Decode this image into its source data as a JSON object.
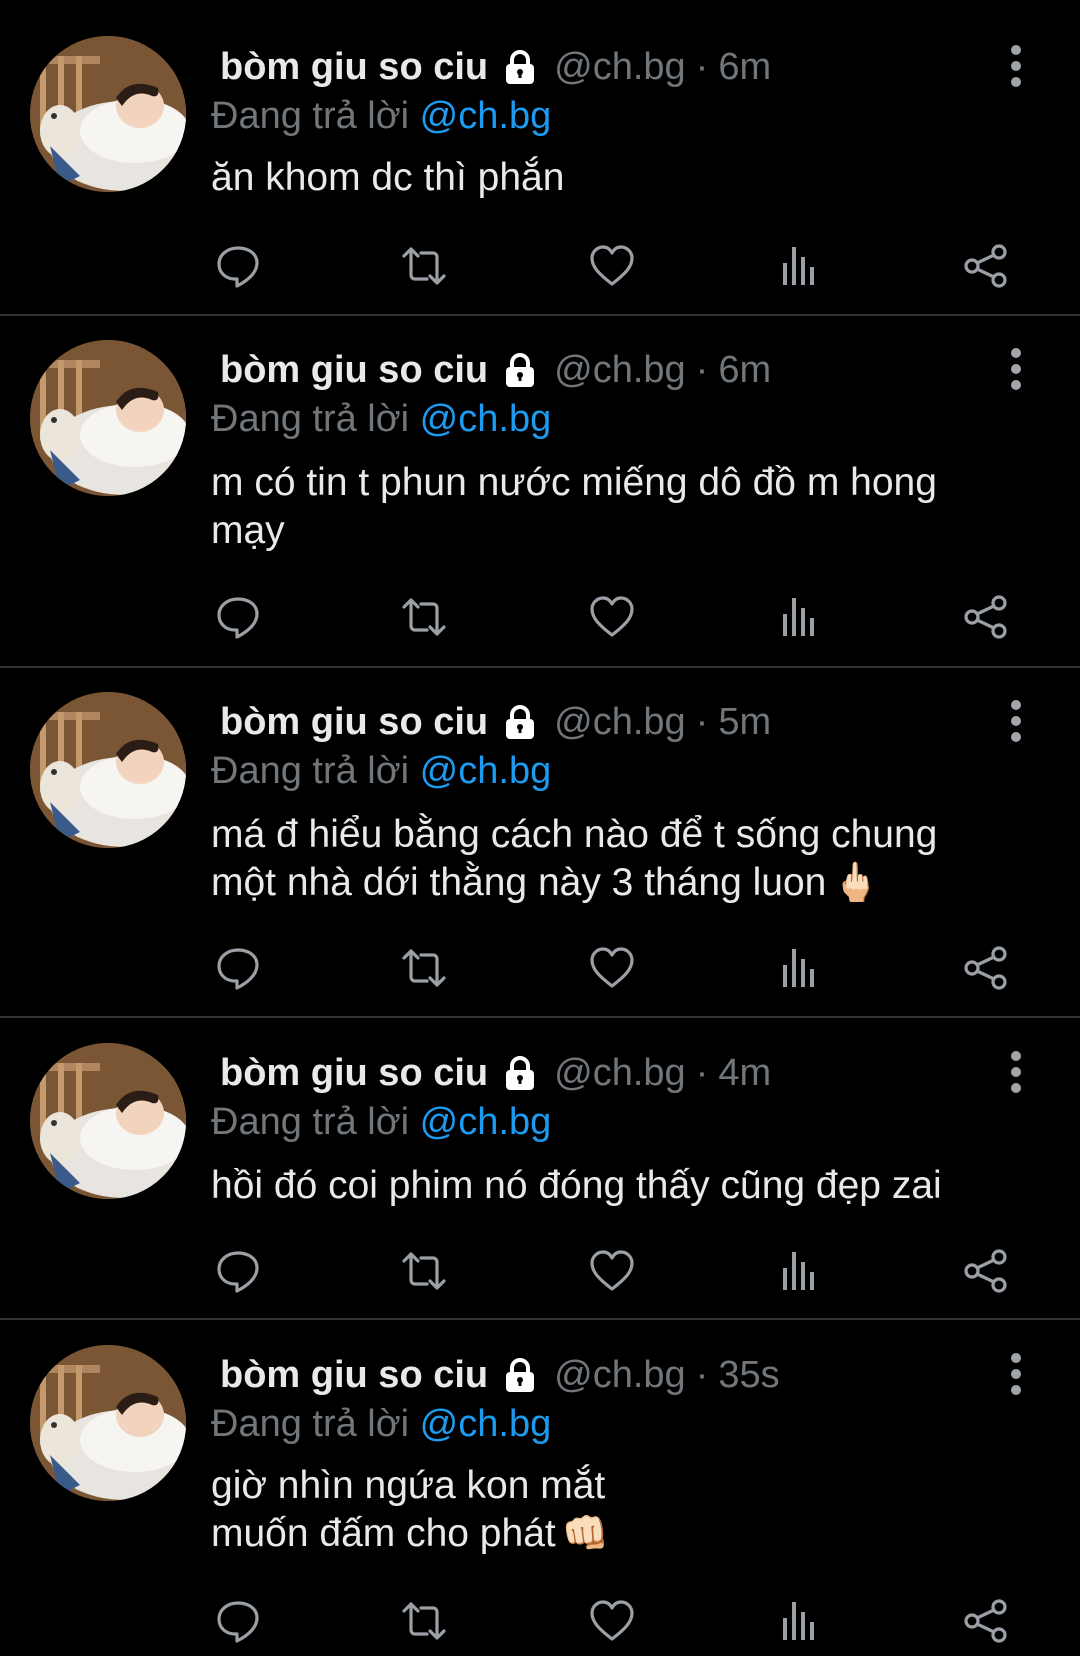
{
  "colors": {
    "background": "#000000",
    "text": "#e7e9ea",
    "muted": "#71767b",
    "accent": "#1d9bf0",
    "divider": "#2f3336"
  },
  "icons": {
    "lock": "lock-icon",
    "more": "more-vertical-icon",
    "reply": "reply-bubble-icon",
    "retweet": "retweet-icon",
    "like": "heart-icon",
    "views": "views-bar-chart-icon",
    "share": "share-icon"
  },
  "tweets": [
    {
      "display_name": "bòm giu so ciu",
      "handle": "@ch.bg",
      "separator": "·",
      "time": "6m",
      "reply_prefix": "Đang trả lời",
      "reply_to": "@ch.bg",
      "text": "ăn khom dc thì phắn",
      "emoji": ""
    },
    {
      "display_name": "bòm giu so ciu",
      "handle": "@ch.bg",
      "separator": "·",
      "time": "6m",
      "reply_prefix": "Đang trả lời",
      "reply_to": "@ch.bg",
      "text": "m có tin t phun nước miếng dô đồ m hong\nmạy",
      "emoji": ""
    },
    {
      "display_name": "bòm giu so ciu",
      "handle": "@ch.bg",
      "separator": "·",
      "time": "5m",
      "reply_prefix": "Đang trả lời",
      "reply_to": "@ch.bg",
      "text": "má đ hiểu bằng cách nào để t sống chung\nmột nhà dới thằng này 3 tháng luon",
      "emoji": "🖕🏻"
    },
    {
      "display_name": "bòm giu so ciu",
      "handle": "@ch.bg",
      "separator": "·",
      "time": "4m",
      "reply_prefix": "Đang trả lời",
      "reply_to": "@ch.bg",
      "text": "hồi đó coi phim nó đóng thấy cũng đẹp zai",
      "emoji": ""
    },
    {
      "display_name": "bòm giu so ciu",
      "handle": "@ch.bg",
      "separator": "·",
      "time": "35s",
      "reply_prefix": "Đang trả lời",
      "reply_to": "@ch.bg",
      "text": "giờ nhìn ngứa kon mắt\nmuốn đấm cho phát",
      "emoji": "👊🏻"
    }
  ]
}
